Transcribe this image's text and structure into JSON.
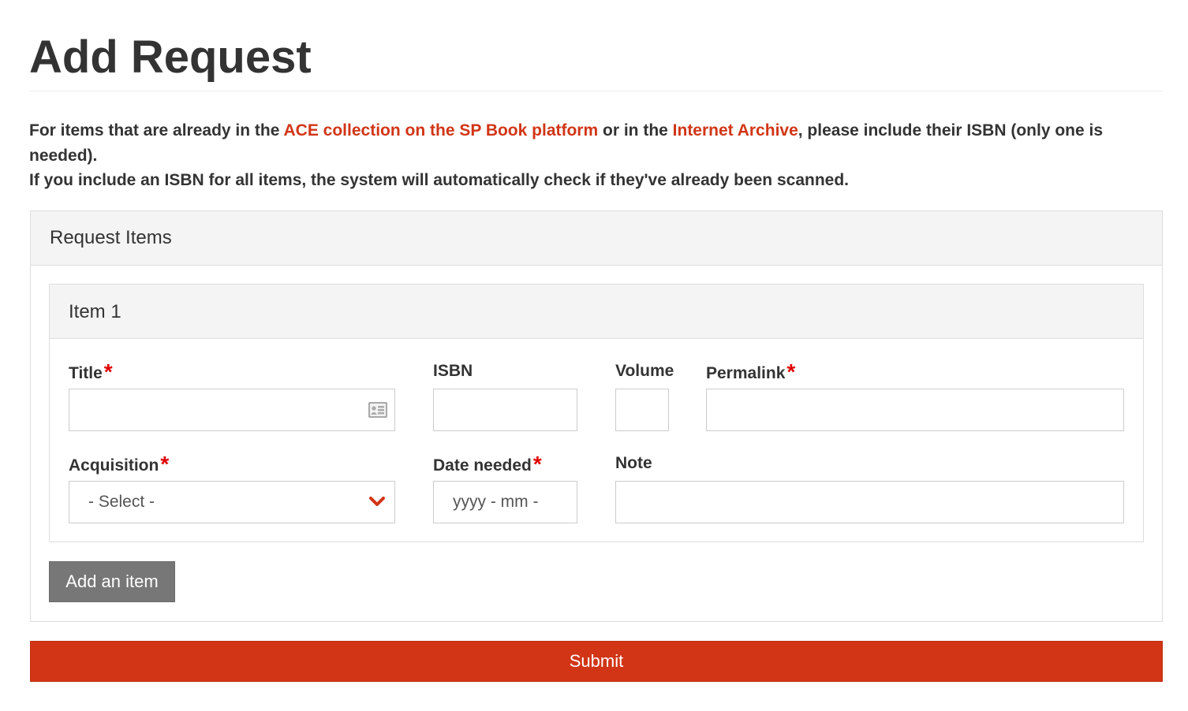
{
  "page": {
    "title": "Add Request"
  },
  "intro": {
    "line1_prefix": "For items that are already in the ",
    "link_ace": "ACE collection on the SP Book platform",
    "line1_middle": " or in the ",
    "link_archive": "Internet Archive",
    "line1_suffix": ", please include their ISBN (only one is needed).",
    "line2": "If you include an ISBN for all items, the system will automatically check if they've already been scanned."
  },
  "panel": {
    "heading": "Request Items"
  },
  "item": {
    "heading": "Item 1",
    "fields": {
      "title_label": "Title",
      "isbn_label": "ISBN",
      "volume_label": "Volume",
      "permalink_label": "Permalink",
      "acquisition_label": "Acquisition",
      "acquisition_value": "- Select -",
      "date_label": "Date needed",
      "date_placeholder": "yyyy - mm -",
      "note_label": "Note",
      "required_mark": "*"
    }
  },
  "buttons": {
    "add_item": "Add an item",
    "submit": "Submit"
  },
  "colors": {
    "accent": "#d13516",
    "required": "#e00000",
    "secondary_button": "#777777"
  },
  "icons": {
    "title_field": "contact-card-icon",
    "acquisition_dropdown": "chevron-down-icon"
  }
}
